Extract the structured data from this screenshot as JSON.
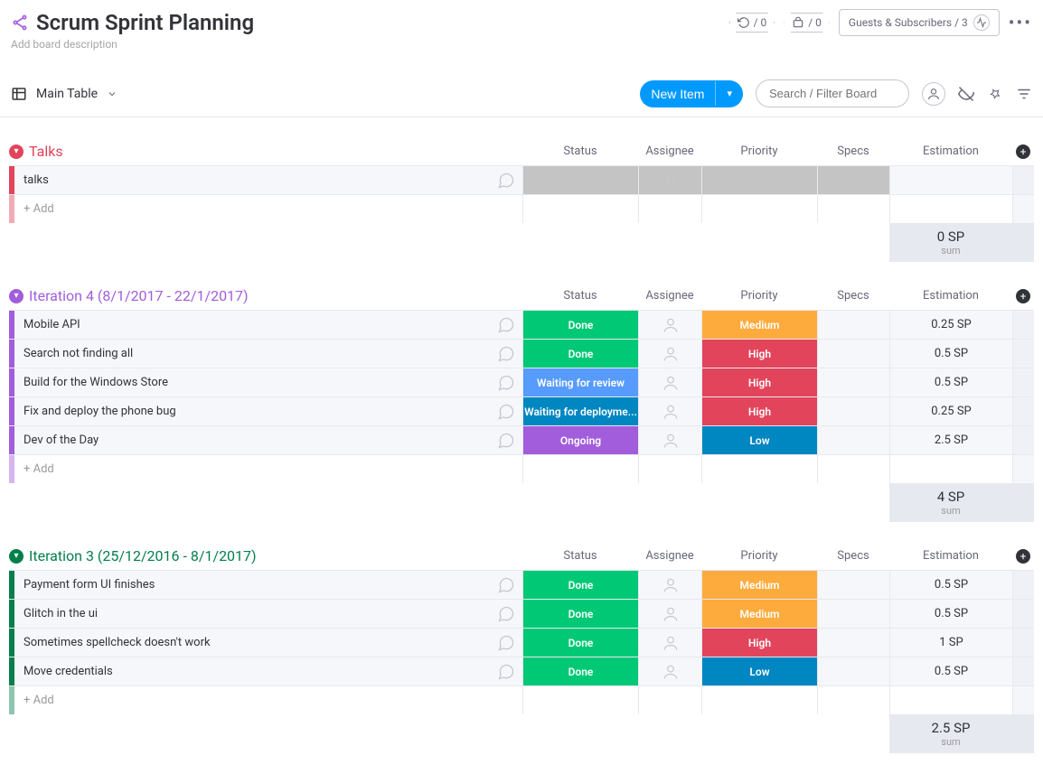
{
  "header": {
    "title": "Scrum Sprint Planning",
    "description_placeholder": "Add board description",
    "hex1": "/ 0",
    "hex2": "/ 0",
    "guests_label": "Guests & Subscribers / 3"
  },
  "toolbar": {
    "view_label": "Main Table",
    "new_item_label": "New Item",
    "search_placeholder": "Search / Filter Board"
  },
  "columns": [
    "Status",
    "Assignee",
    "Priority",
    "Specs",
    "Estimation"
  ],
  "status_colors": {
    "Done": "#00c875",
    "Waiting for review": "#579bfc",
    "Waiting for deployme...": "#0086c0",
    "Ongoing": "#a25ddc"
  },
  "priority_colors": {
    "Medium": "#fdab3d",
    "High": "#e2445c",
    "Low": "#0086c0"
  },
  "groups": [
    {
      "title": "Talks",
      "color": "#e2445c",
      "items": [
        {
          "name": "talks",
          "status": "",
          "priority": "",
          "estimation": "",
          "gray_cells": true
        }
      ],
      "add_label": "+ Add",
      "sum": "0 SP",
      "sum_label": "sum"
    },
    {
      "title": "Iteration 4 (8/1/2017 - 22/1/2017)",
      "color": "#a25ddc",
      "items": [
        {
          "name": "Mobile API",
          "status": "Done",
          "priority": "Medium",
          "estimation": "0.25 SP"
        },
        {
          "name": "Search not finding all",
          "status": "Done",
          "priority": "High",
          "estimation": "0.5 SP"
        },
        {
          "name": "Build for the Windows Store",
          "status": "Waiting for review",
          "priority": "High",
          "estimation": "0.5 SP"
        },
        {
          "name": "Fix and deploy the phone bug",
          "status": "Waiting for deployme...",
          "priority": "High",
          "estimation": "0.25 SP"
        },
        {
          "name": "Dev of the Day",
          "status": "Ongoing",
          "priority": "Low",
          "estimation": "2.5 SP"
        }
      ],
      "add_label": "+ Add",
      "sum": "4 SP",
      "sum_label": "sum"
    },
    {
      "title": "Iteration 3 (25/12/2016 - 8/1/2017)",
      "color": "#037f4c",
      "items": [
        {
          "name": "Payment form UI finishes",
          "status": "Done",
          "priority": "Medium",
          "estimation": "0.5 SP"
        },
        {
          "name": "Glitch in the ui",
          "status": "Done",
          "priority": "Medium",
          "estimation": "0.5 SP"
        },
        {
          "name": "Sometimes spellcheck doesn't work",
          "status": "Done",
          "priority": "High",
          "estimation": "1 SP"
        },
        {
          "name": "Move credentials",
          "status": "Done",
          "priority": "Low",
          "estimation": "0.5 SP"
        }
      ],
      "add_label": "+ Add",
      "sum": "2.5 SP",
      "sum_label": "sum"
    }
  ]
}
